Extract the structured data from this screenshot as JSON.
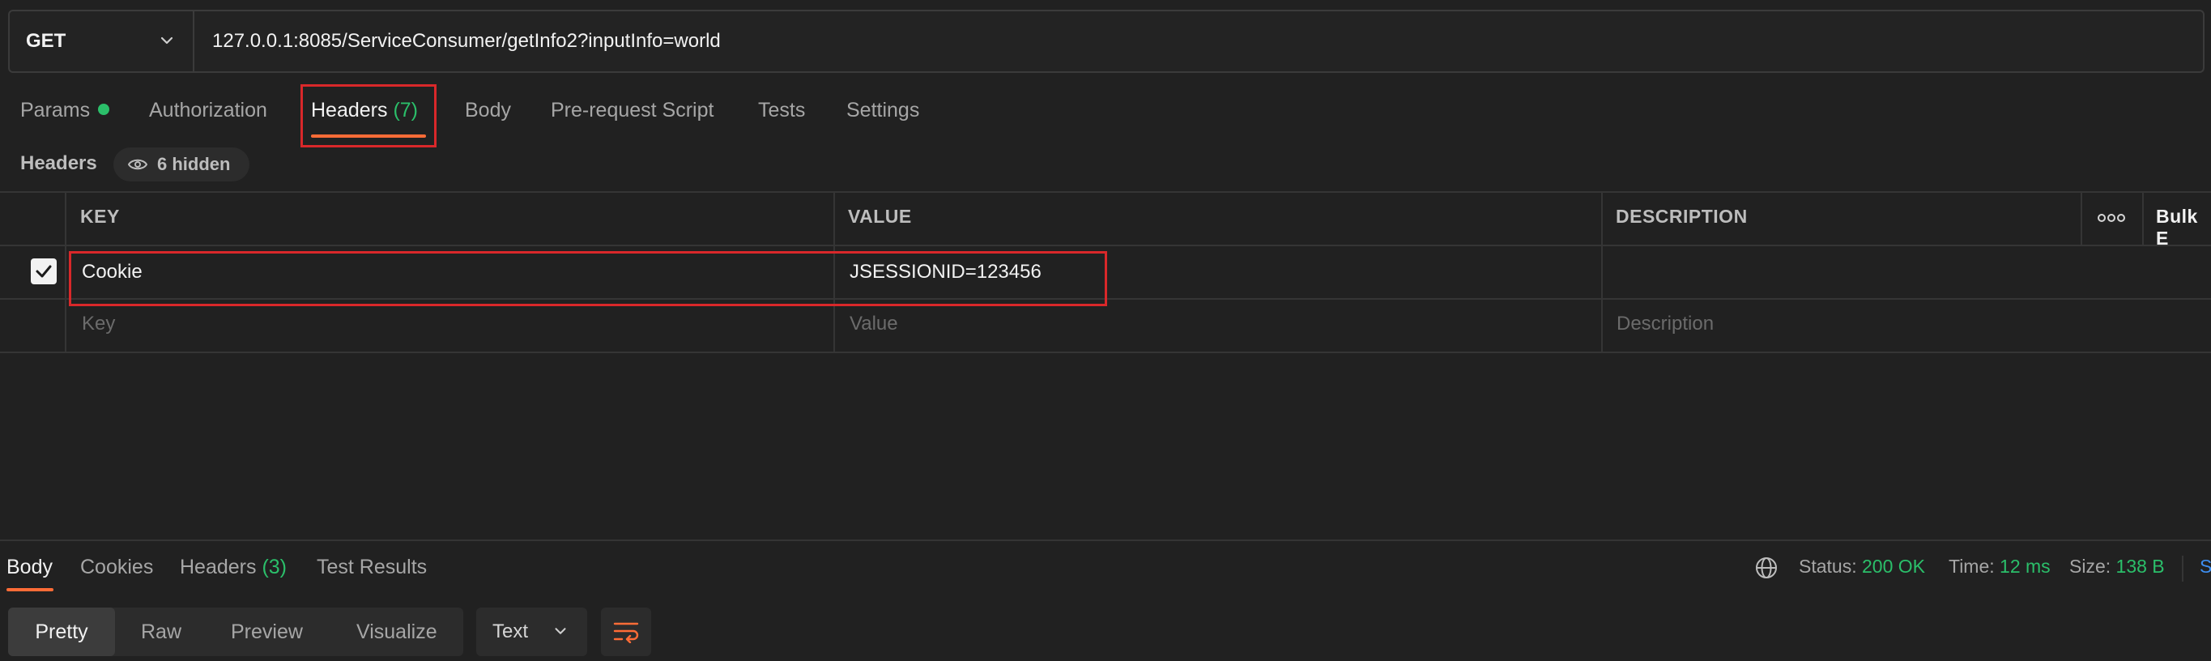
{
  "request": {
    "method": "GET",
    "url": "127.0.0.1:8085/ServiceConsumer/getInfo2?inputInfo=world"
  },
  "request_tabs": [
    {
      "label": "Params",
      "indicator": "green-dot"
    },
    {
      "label": "Authorization"
    },
    {
      "label": "Headers",
      "count": "(7)",
      "active": true
    },
    {
      "label": "Body"
    },
    {
      "label": "Pre-request Script"
    },
    {
      "label": "Tests"
    },
    {
      "label": "Settings"
    }
  ],
  "headers_section": {
    "title": "Headers",
    "hidden_label": "6 hidden",
    "columns": {
      "key": "KEY",
      "value": "VALUE",
      "description": "DESCRIPTION",
      "bulk_edit": "Bulk E"
    },
    "rows": [
      {
        "checked": true,
        "key": "Cookie",
        "value": "JSESSIONID=123456",
        "description": ""
      }
    ],
    "placeholders": {
      "key": "Key",
      "value": "Value",
      "description": "Description"
    }
  },
  "response": {
    "tabs": [
      {
        "label": "Body",
        "active": true
      },
      {
        "label": "Cookies"
      },
      {
        "label": "Headers",
        "count": "(3)"
      },
      {
        "label": "Test Results"
      }
    ],
    "status_label": "Status:",
    "status_value": "200 OK",
    "time_label": "Time:",
    "time_value": "12 ms",
    "size_label": "Size:",
    "size_value": "138 B",
    "save_partial": "S",
    "view_modes": [
      "Pretty",
      "Raw",
      "Preview",
      "Visualize"
    ],
    "format": "Text"
  },
  "colors": {
    "accent": "#ff6c37",
    "success": "#2bbf6a",
    "highlight_box": "#d9282a",
    "link": "#3d8ef0"
  },
  "icons": [
    "chevron-down-icon",
    "eye-icon",
    "checkmark-icon",
    "more-horizontal-icon",
    "globe-icon",
    "wrap-lines-icon"
  ]
}
